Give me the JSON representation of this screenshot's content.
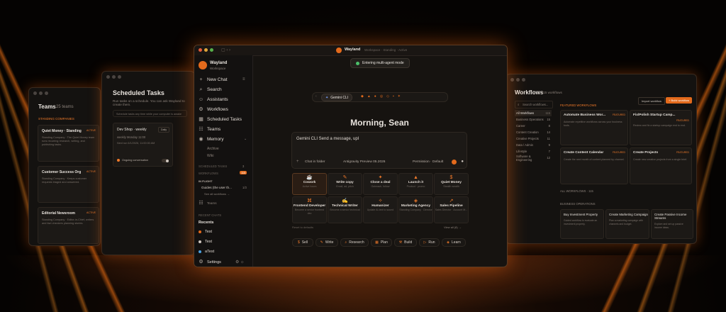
{
  "teams_panel": {
    "title": "Teams",
    "count": "25 teams",
    "section": "STANDING COMPANIES",
    "items": [
      {
        "name": "Quiet Money · Standing",
        "tag": "ACTIVE",
        "desc": "Standing Company · The Quiet Money team runs recurring research, writing, and publishing tasks."
      },
      {
        "name": "Customer Success Org",
        "tag": "ACTIVE",
        "desc": "Standing Company · Keeps customer requests triaged and answered."
      },
      {
        "name": "Editorial Newsroom",
        "tag": "ACTIVE",
        "desc": "Standing Company · Editor-in-Chief, writers and fact checkers planning stories."
      }
    ]
  },
  "scheduled_panel": {
    "title": "Scheduled Tasks",
    "subtitle": "Run tasks on a schedule. You can ask Wayland to create them.",
    "hint": "Schedule tasks any time while your computer is awake",
    "task": {
      "name": "Dev Shop · weekly",
      "badge": "Daily",
      "freq": "weekly Monday 11:00",
      "next": "Next run 6/1/2026, 11:00:00 AM",
      "status": "Ongoing conversation"
    }
  },
  "workflows_panel": {
    "title": "Workflows",
    "count": "115 workflows",
    "search_placeholder": "Search workflows...",
    "import_label": "Import workflow",
    "create_label": "+ Build workflow",
    "categories": [
      {
        "label": "All Workflows",
        "count": "115"
      },
      {
        "label": "Business Operations",
        "count": "15"
      },
      {
        "label": "Career",
        "count": "8"
      },
      {
        "label": "Content Creation",
        "count": "14"
      },
      {
        "label": "Creative Projects",
        "count": "11"
      },
      {
        "label": "Data / Admin",
        "count": "9"
      },
      {
        "label": "Lifestyle",
        "count": "7"
      },
      {
        "label": "Software & Engineering",
        "count": "12"
      }
    ],
    "featured_label": "FEATURED WORKFLOWS",
    "featured": [
      {
        "name": "Automate Business Wor...",
        "tag": "FEATURED",
        "desc": "Automate repetitive workflows across your business tools."
      },
      {
        "name": "Fix/Polish Startup Camp...",
        "tag": "FEATURED",
        "desc": "Review and fix a startup campaign end to end."
      },
      {
        "name": "Create Content Calendar",
        "tag": "FEATURED",
        "desc": "Create the next month of content planned by channel."
      },
      {
        "name": "Create Projects",
        "tag": "FEATURED",
        "desc": "Create new creative projects from a single brief."
      }
    ],
    "all_label": "ALL WORKFLOWS",
    "all_count": "115",
    "biz_label": "BUSINESS OPERATIONS",
    "biz": [
      {
        "name": "Buy Investment Property",
        "desc": "Guided workflow to evaluate an investment property."
      },
      {
        "name": "Create Marketing Campaign",
        "desc": "Plan a marketing campaign with channels and budget."
      },
      {
        "name": "Create Passive Income Streams",
        "desc": "Explore and set up passive income ideas."
      }
    ]
  },
  "main_window": {
    "app_name": "Wayland",
    "app_sub": "Workspace",
    "title_bar": "Wayland",
    "title_path": "Workspace · Standing · Active",
    "toast": "Entering multi-agent mode",
    "sidebar": {
      "new_chat": "New Chat",
      "items": [
        "Search",
        "Assistants",
        "Workflows",
        "Scheduled Tasks",
        "Teams",
        "Memory"
      ],
      "memory_sub": [
        "Archive",
        "Wiki"
      ],
      "scheduled_section": "SCHEDULED TASKS",
      "scheduled_count": "3",
      "workflows_section": "WORKFLOWS",
      "workflows_count": "115",
      "in_flight": "IN FLIGHT",
      "in_flight_item": "Guides (the user th...",
      "in_flight_progress": "1/3",
      "see_all": "See all workflows →",
      "teams_label": "Teams",
      "recent_chats": "RECENT CHATS",
      "recents_label": "Recents",
      "recents": [
        "Test",
        "Test",
        "aTest"
      ],
      "settings": "Settings"
    },
    "model_selector": "Gemini CLI",
    "greeting": "Morning, Sean",
    "prompt_placeholder": "Gemini CLI Send a message, upl",
    "prompt_chat_folder": "Chat in folder",
    "prompt_model": "Antigravity Preview 05.2026",
    "prompt_permission": "Permission · Default",
    "tiles": [
      {
        "icon": "☕",
        "label": "Cowork",
        "sub": "Active hours"
      },
      {
        "icon": "✎",
        "label": "Write copy",
        "sub": "Email, ad, pitch"
      },
      {
        "icon": "✦",
        "label": "Close a deal",
        "sub": "Outreach, follow"
      },
      {
        "icon": "▲",
        "label": "Launch it",
        "sub": "Product · promo"
      },
      {
        "icon": "$",
        "label": "Quiet Money",
        "sub": "Stealth wealth"
      },
      {
        "icon": "⌘",
        "label": "Frontend Developer",
        "sub": "Become a senior frontend dev"
      },
      {
        "icon": "✍",
        "label": "Technical Writer",
        "sub": "Become a senior technical"
      },
      {
        "icon": "✧",
        "label": "Humanizer",
        "sub": "Update AI-text to sound"
      },
      {
        "icon": "◈",
        "label": "Marketing Agency",
        "sub": "Standing Company · Director"
      },
      {
        "icon": "↗",
        "label": "Sales Pipeline",
        "sub": "Sales Director · Account M..."
      }
    ],
    "reset_defaults": "Reset to defaults",
    "view_all": "View all (8) →",
    "chips": [
      "Sell",
      "Write",
      "Research",
      "Plan",
      "Build",
      "Run",
      "Learn"
    ]
  }
}
